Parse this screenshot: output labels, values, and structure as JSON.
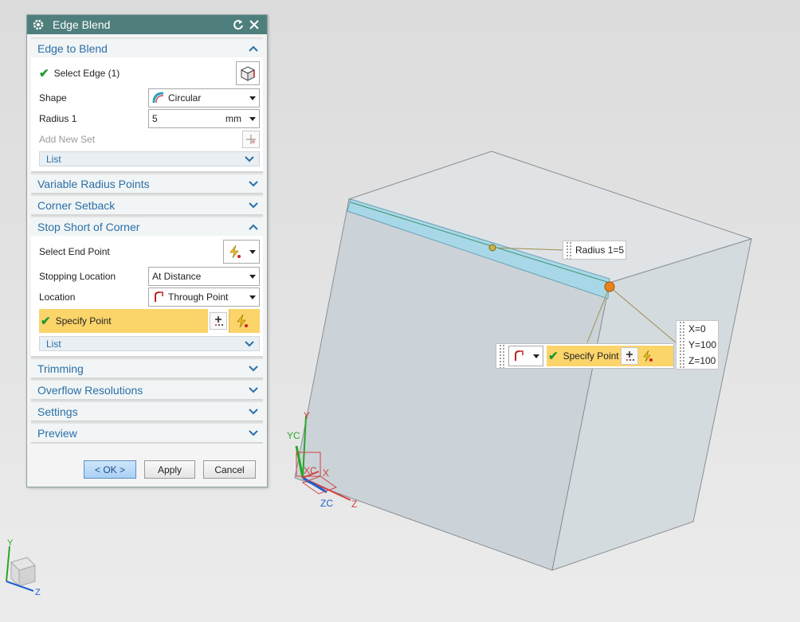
{
  "dialog": {
    "title": "Edge Blend",
    "edge_to_blend": {
      "header": "Edge to Blend",
      "select_edge": "Select Edge (1)",
      "shape_label": "Shape",
      "shape_value": "Circular",
      "radius_label": "Radius 1",
      "radius_value": "5",
      "radius_unit": "mm",
      "add_new_set": "Add New Set",
      "list": "List"
    },
    "collapsed_sections": [
      "Variable Radius Points",
      "Corner Setback"
    ],
    "stop_short": {
      "header": "Stop Short of Corner",
      "select_end_point": "Select End Point",
      "stopping_location_label": "Stopping Location",
      "stopping_location_value": "At Distance",
      "location_label": "Location",
      "location_value": "Through Point",
      "specify_point": "Specify Point",
      "list": "List"
    },
    "bottom_sections": [
      "Trimming",
      "Overflow Resolutions",
      "Settings",
      "Preview"
    ],
    "buttons": {
      "ok": "< OK >",
      "apply": "Apply",
      "cancel": "Cancel"
    }
  },
  "viewport": {
    "radius_label": "Radius 1=5",
    "specify_point": "Specify Point",
    "coords": {
      "x": "X=0",
      "y": "Y=100",
      "z": "Z=100"
    },
    "triad": {
      "yc": "YC",
      "xc": "XC",
      "zc": "ZC",
      "y": "Y",
      "x": "X",
      "z": "Z"
    },
    "corner_triad": {
      "y": "Y",
      "z": "Z"
    }
  },
  "colors": {
    "title_bar": "#4e7f7c",
    "section_header_text": "#2a6fa8",
    "highlight": "#fbd46a",
    "check": "#1f9a2e",
    "selected_edge": "#a8d8e8",
    "end_point": "#e8831c"
  }
}
